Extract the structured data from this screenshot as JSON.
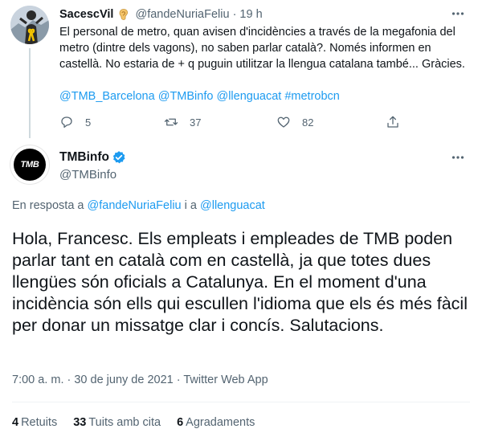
{
  "parent_tweet": {
    "display_name": "SacescVil",
    "emoji_icon": "ear-icon",
    "handle": "@fandeNuriaFeliu",
    "separator": "·",
    "time": "19 h",
    "text": "El personal de metro, quan avisen d'incidències a través de la megafonia del metro (dintre dels vagons), no saben parlar català?. Només informen en castellà. No estaria de + q puguin utilitzar la llengua catalana també... Gràcies.",
    "hashtags_mentions": [
      "@TMB_Barcelona",
      "@TMBinfo",
      "@llenguacat",
      "#metrobcn"
    ],
    "actions": {
      "replies": "5",
      "retweets": "37",
      "likes": "82"
    }
  },
  "main_tweet": {
    "display_name": "TMBinfo",
    "handle": "@TMBinfo",
    "avatar_text": "TMB",
    "reply_prefix": "En resposta a",
    "reply_to_1": "@fandeNuriaFeliu",
    "reply_join": "i a",
    "reply_to_2": "@llenguacat",
    "text": "Hola, Francesc. Els empleats i empleades de TMB poden parlar tant en català com en castellà, ja que totes dues llengües són oficials a Catalunya. En el moment d'una incidència són ells qui escullen l'idioma que els és més fàcil per donar un missatge clar i concís. Salutacions.",
    "meta": "7:00 a. m. · 30 de juny de 2021 · Twitter Web App",
    "stats": {
      "retweets_count": "4",
      "retweets_label": "Retuits",
      "quotes_count": "33",
      "quotes_label": "Tuits amb cita",
      "likes_count": "6",
      "likes_label": "Agradaments"
    }
  },
  "colors": {
    "link": "#1d9bf0",
    "secondary_text": "#536471",
    "primary_text": "#0f1419",
    "verified": "#1d9bf0"
  }
}
